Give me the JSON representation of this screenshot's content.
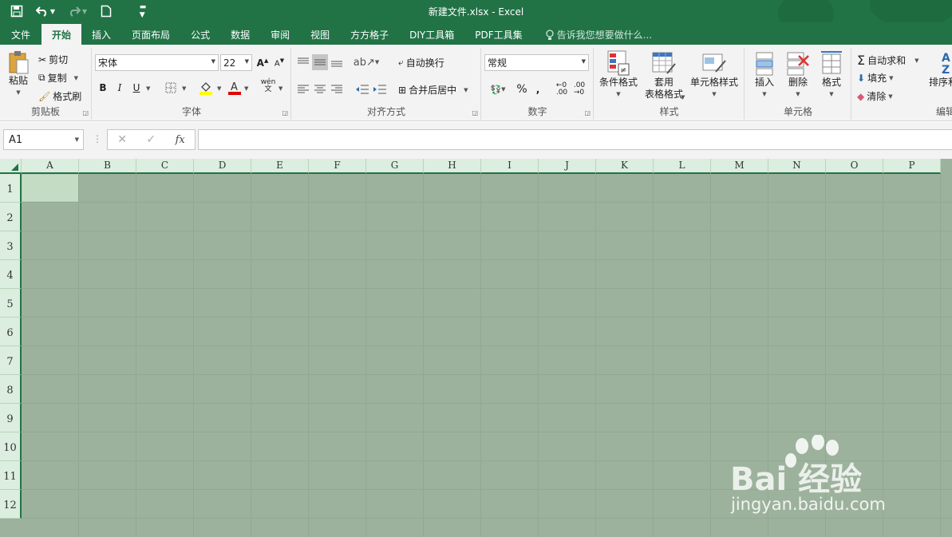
{
  "window": {
    "title": "新建文件.xlsx - Excel"
  },
  "tabs": [
    {
      "label": "文件"
    },
    {
      "label": "开始"
    },
    {
      "label": "插入"
    },
    {
      "label": "页面布局"
    },
    {
      "label": "公式"
    },
    {
      "label": "数据"
    },
    {
      "label": "审阅"
    },
    {
      "label": "视图"
    },
    {
      "label": "方方格子"
    },
    {
      "label": "DIY工具箱"
    },
    {
      "label": "PDF工具集"
    }
  ],
  "tell_me": "告诉我您想要做什么...",
  "ribbon": {
    "clipboard": {
      "paste": "粘贴",
      "cut": "剪切",
      "copy": "复制",
      "format_painter": "格式刷",
      "label": "剪贴板"
    },
    "font": {
      "name": "宋体",
      "size": "22",
      "label": "字体",
      "bold": "B",
      "italic": "I",
      "underline": "U",
      "phonetic": "wén 文"
    },
    "alignment": {
      "wrap_text": "自动换行",
      "merge_center": "合并后居中",
      "label": "对齐方式"
    },
    "number": {
      "format": "常规",
      "label": "数字"
    },
    "styles": {
      "conditional": "条件格式",
      "format_table_l1": "套用",
      "format_table_l2": "表格格式",
      "cell_styles": "单元格样式",
      "label": "样式"
    },
    "cells": {
      "insert": "插入",
      "delete": "删除",
      "format": "格式",
      "label": "单元格"
    },
    "editing": {
      "autosum": "自动求和",
      "fill": "填充",
      "clear": "清除",
      "sort": "排序和",
      "label": "编辑"
    }
  },
  "formula_bar": {
    "name_box": "A1",
    "fx": "fx",
    "value": ""
  },
  "columns": [
    "A",
    "B",
    "C",
    "D",
    "E",
    "F",
    "G",
    "H",
    "I",
    "J",
    "K",
    "L",
    "M",
    "N",
    "O",
    "P"
  ],
  "rows": [
    "1",
    "2",
    "3",
    "4",
    "5",
    "6",
    "7",
    "8",
    "9",
    "10",
    "11",
    "12"
  ],
  "watermark": {
    "text": "Bai  经验",
    "url": "jingyan.baidu.com"
  },
  "colors": {
    "brand": "#217346",
    "grid_fill": "#9db29d",
    "header_fill": "#dbeedf"
  }
}
